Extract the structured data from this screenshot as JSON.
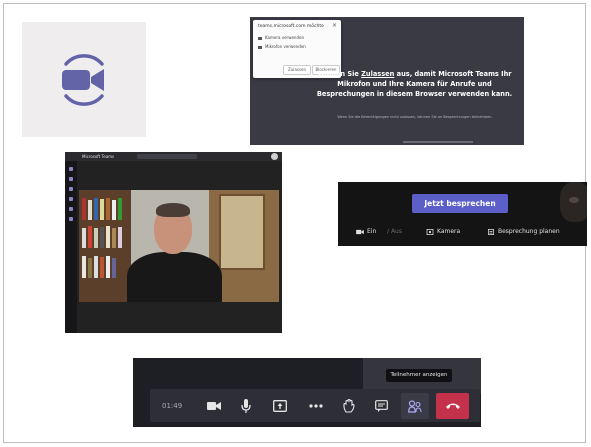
{
  "colors": {
    "teams_purple": "#5b5fc7",
    "hangup_red": "#c4314b",
    "icon_purple": "#6264a7"
  },
  "panel_icon": {
    "icon": "video-camera-icon"
  },
  "permission_panel": {
    "popup_title": "teams.microsoft.com möchte",
    "popup_options": [
      "Kamera verwenden",
      "Mikrofon verwenden"
    ],
    "popup_block": "Blockieren",
    "popup_allow": "Zulassen",
    "message_before": "Wählen Sie ",
    "message_link": "Zulassen",
    "message_after": " aus, damit Microsoft Teams Ihr Mikrofon und Ihre Kamera für Anrufe und Besprechungen in diesem Browser verwenden kann.",
    "note": "Wenn Sie die Berechtigungen nicht zulassen, können Sie an Besprechungen teilnehmen."
  },
  "teams_app_panel": {
    "title": "Microsoft Teams"
  },
  "join_panel": {
    "join_button": "Jetzt besprechen",
    "option_video": "Ein",
    "option_audio": "Aus",
    "option_camera": "Kamera",
    "option_schedule": "Besprechung planen"
  },
  "call_toolbar": {
    "timer": "01:49",
    "tooltip": "Teilnehmer anzeigen",
    "buttons": [
      "video-camera-icon",
      "microphone-icon",
      "share-screen-icon",
      "more-options-icon",
      "raise-hand-icon",
      "chat-icon",
      "participants-icon",
      "hang-up-icon"
    ]
  }
}
